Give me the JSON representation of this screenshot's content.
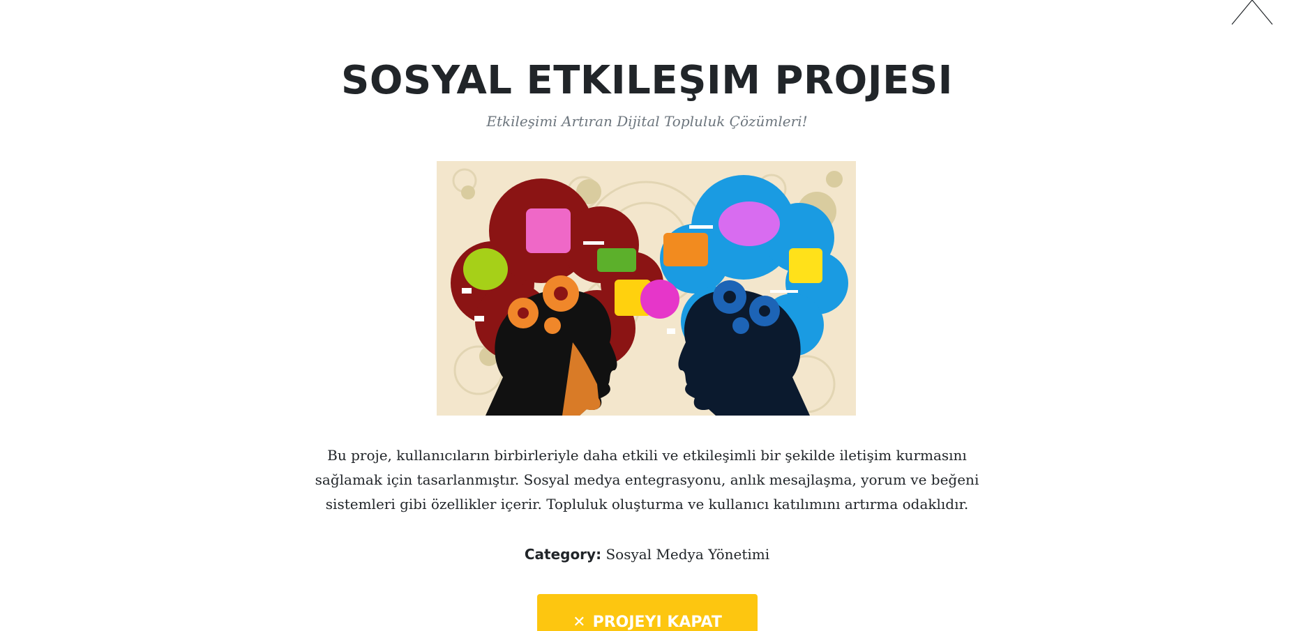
{
  "modal": {
    "title": "SOSYAL ETKILEŞIM PROJESI",
    "subtitle": "Etkileşimi Artıran Dijital Topluluk Çözümleri!",
    "image_alt": "two heads with gears and speech bubbles illustration",
    "description": "Bu proje, kullanıcıların birbirleriyle daha etkili ve etkileşimli bir şekilde iletişim kurmasını sağlamak için tasarlanmıştır. Sosyal medya entegrasyonu, anlık mesajlaşma, yorum ve beğeni sistemleri gibi özellikler içerir. Topluluk oluşturma ve kullanıcı katılımını artırma odaklıdır.",
    "category_label": "Category:",
    "category_value": "Sosyal Medya Yönetimi",
    "close_button_icon": "✕",
    "close_button_label": "PROJEYI KAPAT",
    "close_icon": "close-icon"
  },
  "colors": {
    "accent": "#fdc610",
    "title": "#212529",
    "subtitle": "#6c757d",
    "hero_bg": "#f3e6cc"
  }
}
